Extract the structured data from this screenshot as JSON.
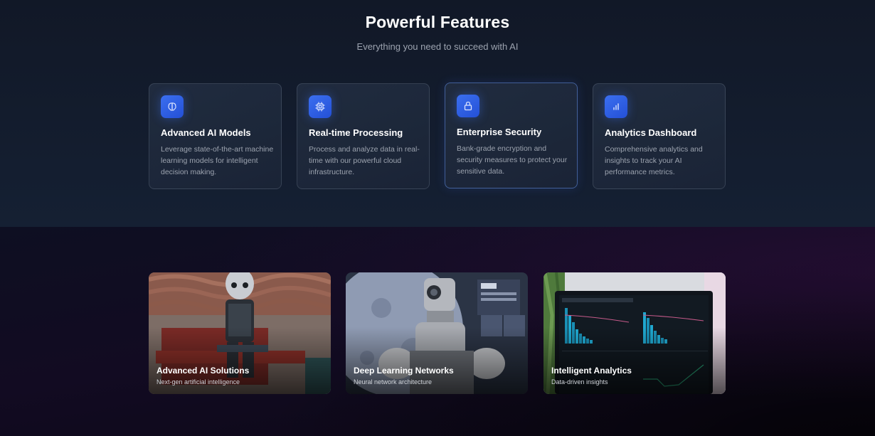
{
  "features": {
    "title": "Powerful Features",
    "subtitle": "Everything you need to succeed with AI",
    "cards": [
      {
        "icon": "brain-icon",
        "title": "Advanced AI Models",
        "description": "Leverage state-of-the-art machine learning models for intelligent decision making."
      },
      {
        "icon": "cpu-chip-icon",
        "title": "Real-time Processing",
        "description": "Process and analyze data in real-time with our powerful cloud infrastructure."
      },
      {
        "icon": "lock-icon",
        "title": "Enterprise Security",
        "description": "Bank-grade encryption and security measures to protect your sensitive data."
      },
      {
        "icon": "bar-chart-icon",
        "title": "Analytics Dashboard",
        "description": "Comprehensive analytics and insights to track your AI performance metrics."
      }
    ]
  },
  "gallery": {
    "cards": [
      {
        "image": "robot-on-bench-image",
        "title": "Advanced AI Solutions",
        "subtitle": "Next-gen artificial intelligence"
      },
      {
        "image": "robot-moon-image",
        "title": "Deep Learning Networks",
        "subtitle": "Neural network architecture"
      },
      {
        "image": "analytics-laptop-image",
        "title": "Intelligent Analytics",
        "subtitle": "Data-driven insights"
      }
    ]
  },
  "colors": {
    "background": "#111827",
    "accent": "#3b6ff0",
    "muted_text": "#9ca3af"
  }
}
